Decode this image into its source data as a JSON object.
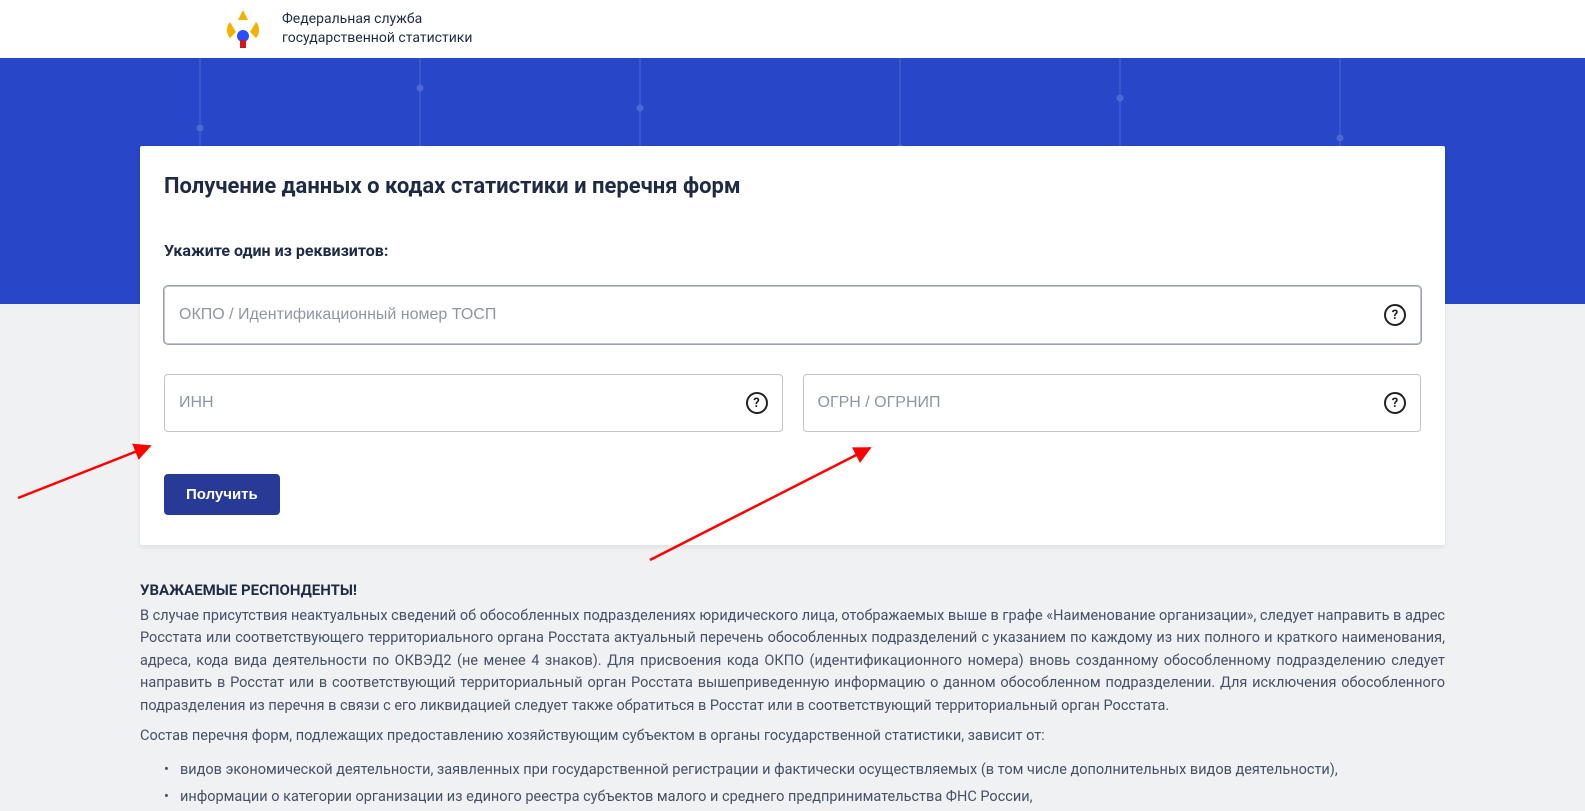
{
  "header": {
    "org_line1": "Федеральная служба",
    "org_line2": "государственной статистики"
  },
  "card": {
    "title": "Получение данных о кодах статистики и перечня форм",
    "subhead": "Укажите один из реквизитов:",
    "okpo_placeholder": "ОКПО / Идентификационный номер ТОСП",
    "inn_placeholder": "ИНН",
    "ogrn_placeholder": "ОГРН / ОГРНИП",
    "submit_label": "Получить"
  },
  "info": {
    "title": "УВАЖАЕМЫЕ РЕСПОНДЕНТЫ!",
    "paragraph1": "В случае присутствия неактуальных сведений об обособленных подразделениях юридического лица, отображаемых выше в графе «Наименование организации», следует направить в адрес Росстата или соответствующего территориального органа Росстата актуальный перечень обособленных подразделений с указанием по каждому из них полного и краткого наименования, адреса, кода вида деятельности по ОКВЭД2 (не менее 4 знаков). Для присвоения кода ОКПО (идентификационного номера) вновь созданному обособленному подразделению следует направить в Росстат или в соответствующий территориальный орган Росстата вышеприведенную информацию о данном обособленном подразделении. Для исключения обособленного подразделения из перечня в связи с его ликвидацией следует также обратиться в Росстат или в соответствующий территориальный орган Росстата.",
    "paragraph2": "Состав перечня форм, подлежащих предоставлению хозяйствующим субъектом в органы государственной статистики, зависит от:",
    "bullets": [
      "видов экономической деятельности, заявленных при государственной регистрации и фактически осуществляемых (в том числе дополнительных видов деятельности),",
      "информации о категории организации из единого реестра субъектов малого и среднего предпринимательства ФНС России,"
    ]
  }
}
